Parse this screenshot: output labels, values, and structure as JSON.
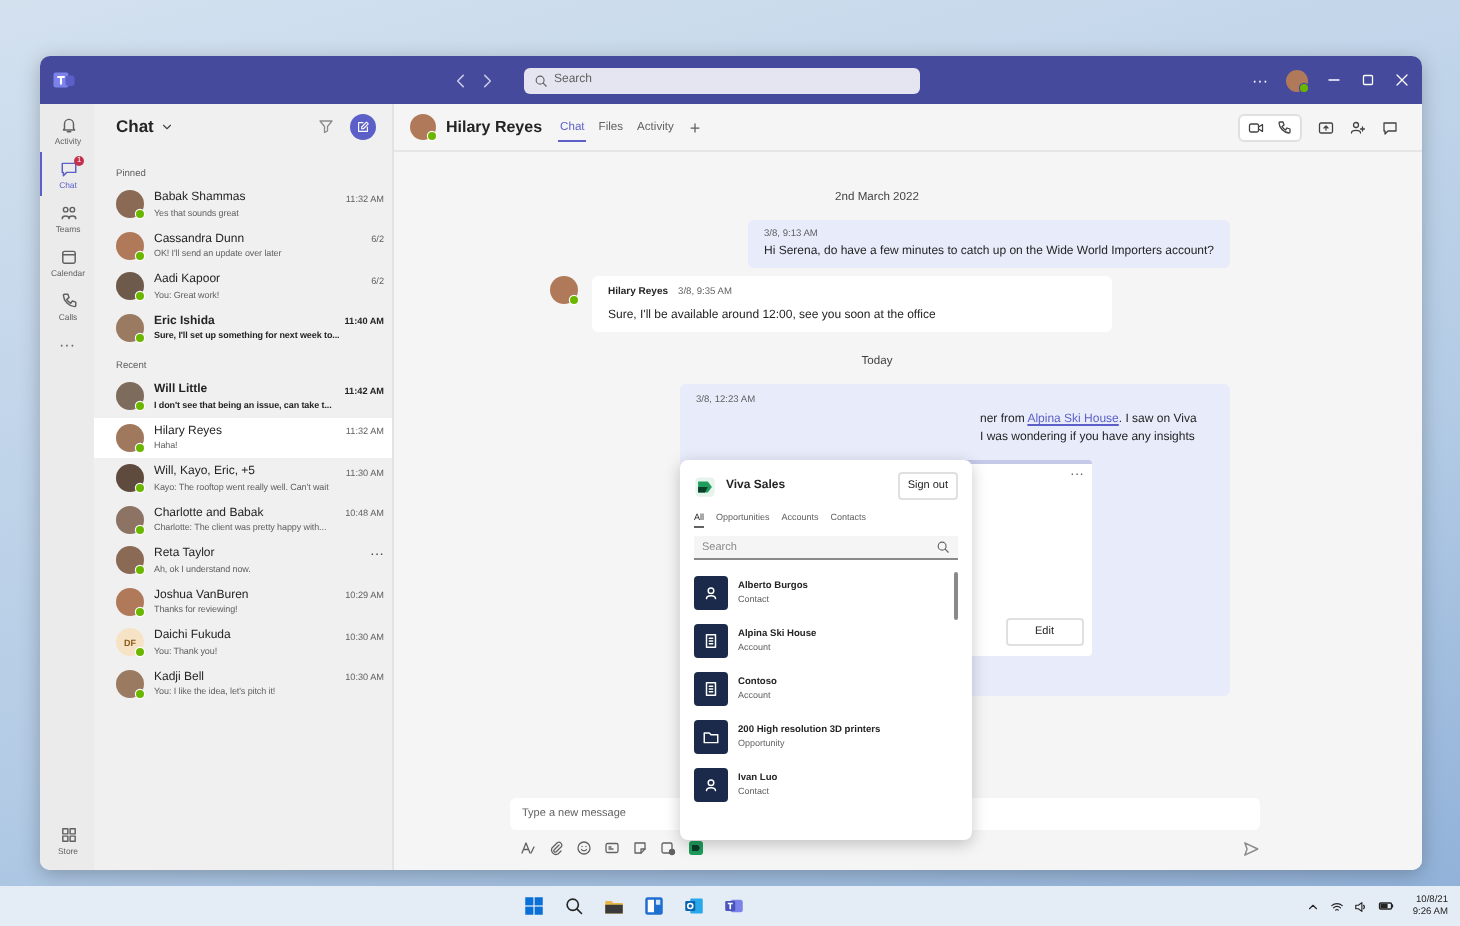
{
  "titlebar": {
    "search_placeholder": "Search",
    "more": "···"
  },
  "rail": {
    "items": [
      {
        "label": "Activity",
        "selected": false
      },
      {
        "label": "Chat",
        "selected": true,
        "badge": "1"
      },
      {
        "label": "Teams",
        "selected": false
      },
      {
        "label": "Calendar",
        "selected": false
      },
      {
        "label": "Calls",
        "selected": false
      }
    ],
    "more": "···",
    "store": "Store"
  },
  "chat_list": {
    "title": "Chat",
    "sections": [
      {
        "label": "Pinned",
        "chats": [
          {
            "name": "Babak Shammas",
            "time": "11:32 AM",
            "preview": "Yes that sounds great",
            "unread": false,
            "selected": false
          },
          {
            "name": "Cassandra Dunn",
            "time": "6/2",
            "preview": "OK! I'll send an update over later",
            "unread": false,
            "selected": false
          },
          {
            "name": "Aadi Kapoor",
            "time": "6/2",
            "preview": "You: Great work!",
            "unread": false,
            "selected": false
          },
          {
            "name": "Eric Ishida",
            "time": "11:40 AM",
            "preview": "Sure, I'll set up something for next week to...",
            "unread": true,
            "selected": false
          }
        ]
      },
      {
        "label": "Recent",
        "chats": [
          {
            "name": "Will Little",
            "time": "11:42 AM",
            "preview": "I don't see that being an issue, can take t...",
            "unread": true,
            "selected": false
          },
          {
            "name": "Hilary Reyes",
            "time": "11:32 AM",
            "preview": "Haha!",
            "unread": false,
            "selected": true
          },
          {
            "name": "Will, Kayo, Eric, +5",
            "time": "11:30 AM",
            "preview": "Kayo: The rooftop went really well. Can't wait",
            "unread": false,
            "selected": false
          },
          {
            "name": "Charlotte and Babak",
            "time": "10:48 AM",
            "preview": "Charlotte: The client was pretty happy with...",
            "unread": false,
            "selected": false
          },
          {
            "name": "Reta Taylor",
            "menu": "···",
            "preview": "Ah, ok I understand now.",
            "unread": false,
            "selected": false
          },
          {
            "name": "Joshua VanBuren",
            "time": "10:29 AM",
            "preview": "Thanks for reviewing!",
            "unread": false,
            "selected": false
          },
          {
            "name": "Daichi Fukuda",
            "initials": "DF",
            "time": "10:30 AM",
            "preview": "You: Thank you!",
            "unread": false,
            "selected": false
          },
          {
            "name": "Kadji Bell",
            "time": "10:30 AM",
            "preview": "You: I like the idea, let's pitch it!",
            "unread": false,
            "selected": false
          }
        ]
      }
    ]
  },
  "conversation": {
    "name": "Hilary Reyes",
    "tabs": [
      {
        "label": "Chat",
        "selected": true
      },
      {
        "label": "Files",
        "selected": false
      },
      {
        "label": "Activity",
        "selected": false
      }
    ],
    "add_tab": "+",
    "messages": [
      {
        "kind": "divider",
        "text": "2nd March 2022"
      },
      {
        "kind": "sent",
        "time": "3/8, 9:13 AM",
        "text": "Hi Serena, do have a few minutes to catch up on the Wide World Importers account?"
      },
      {
        "kind": "received",
        "author": "Hilary Reyes",
        "time": "3/8, 9:35 AM",
        "text": "Sure, I'll be available around 12:00, see you soon at the office"
      },
      {
        "kind": "divider",
        "text": "Today"
      },
      {
        "kind": "sent_card",
        "time": "3/8, 12:23 AM",
        "line_1": {
          "before": "ner from ",
          "link": "Alpina Ski House",
          "after": ". I saw on Viva"
        },
        "line_2": "I was wondering if you have any insights",
        "card": {
          "menu": "···",
          "button": "Edit"
        }
      }
    ],
    "compose": {
      "placeholder": "Type a new message"
    }
  },
  "viva_sales": {
    "title": "Viva Sales",
    "sign_out": "Sign out",
    "tabs": [
      {
        "label": "All",
        "selected": true
      },
      {
        "label": "Opportunities",
        "selected": false
      },
      {
        "label": "Accounts",
        "selected": false
      },
      {
        "label": "Contacts",
        "selected": false
      }
    ],
    "search_placeholder": "Search",
    "results": [
      {
        "kind": "contact",
        "name": "Alberto Burgos",
        "type": "Contact"
      },
      {
        "kind": "account",
        "name": "Alpina Ski House",
        "type": "Account"
      },
      {
        "kind": "account",
        "name": "Contoso",
        "type": "Account"
      },
      {
        "kind": "opportunity",
        "name": "200 High resolution 3D printers",
        "type": "Opportunity"
      },
      {
        "kind": "contact",
        "name": "Ivan Luo",
        "type": "Contact"
      }
    ]
  },
  "taskbar": {
    "date": "10/8/21",
    "time": "9:26 AM"
  }
}
